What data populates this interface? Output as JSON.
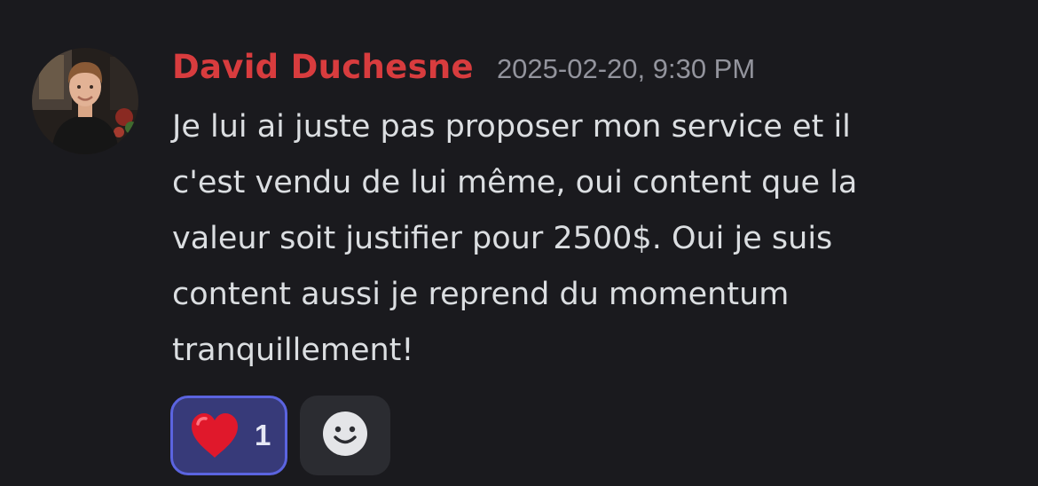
{
  "message": {
    "author": "David Duchesne",
    "timestamp": "2025-02-20, 9:30 PM",
    "lines": [
      "Je lui ai juste pas proposer mon service et il",
      "c'est vendu de lui même, oui content que la",
      "valeur soit justifier pour 2500$. Oui je suis",
      "content aussi je reprend du momentum",
      "tranquillement!"
    ],
    "author_color": "#d83c3e"
  },
  "reactions": [
    {
      "icon": "red-heart-icon",
      "count": "1",
      "selected": true
    }
  ],
  "add_reaction": {
    "icon": "smiley-face-icon"
  }
}
